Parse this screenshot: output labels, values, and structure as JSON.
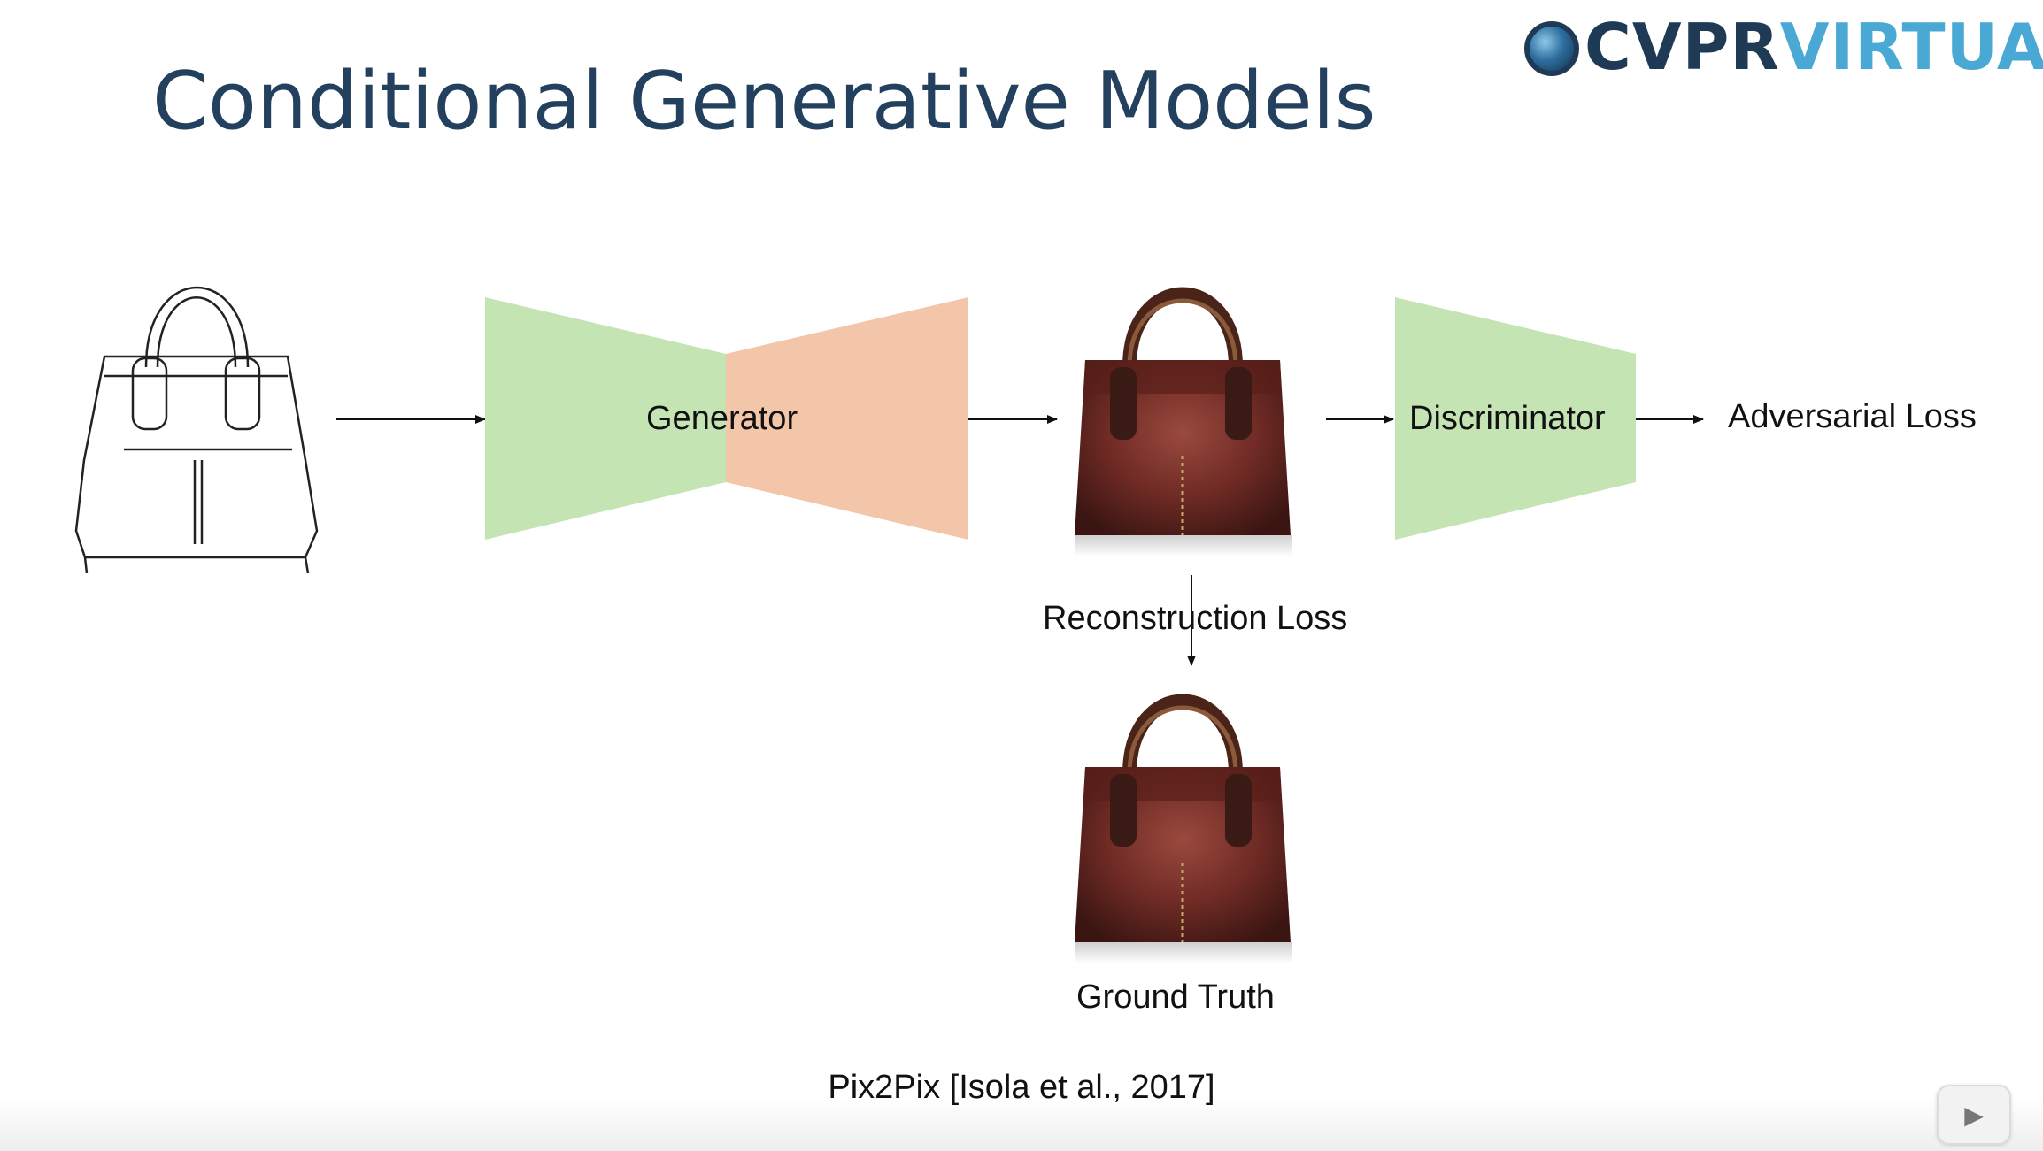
{
  "slide": {
    "title": "Conditional Generative Models",
    "logo": {
      "cvpr": "CVPR",
      "virtual": "VIRTUAL",
      "icon": "globe-icon"
    },
    "generator_label": "Generator",
    "discriminator_label": "Discriminator",
    "adversarial_loss_label": "Adversarial Loss",
    "reconstruction_loss_label": "Reconstruction Loss",
    "ground_truth_label": "Ground Truth",
    "citation": "Pix2Pix [Isola et al., 2017]",
    "colors": {
      "title": "#23405e",
      "encoder": "#c5e4b4",
      "decoder": "#f3c6aa",
      "discriminator": "#c5e4b4",
      "bag_leather": "#6e2a24",
      "logo_dark": "#1e3a55",
      "logo_light": "#49a9d4"
    }
  }
}
